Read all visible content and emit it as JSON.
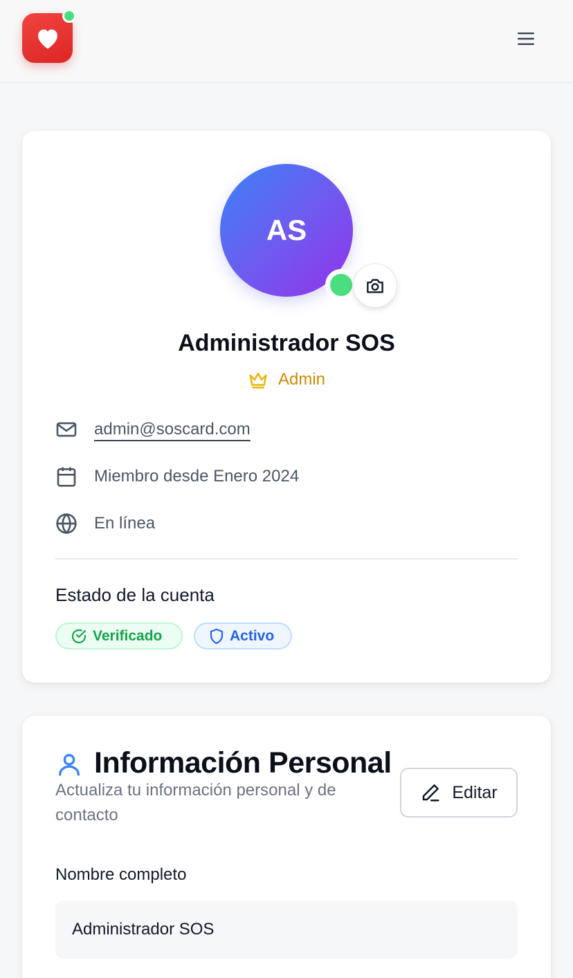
{
  "header": {
    "logo_icon": "heart-icon",
    "menu_icon": "hamburger-menu-icon"
  },
  "profile": {
    "initials": "AS",
    "name": "Administrador SOS",
    "role": "Admin",
    "email": "admin@soscard.com",
    "member_since": "Miembro desde Enero 2024",
    "presence": "En línea",
    "status_title": "Estado de la cuenta",
    "badges": {
      "verified": "Verificado",
      "active": "Activo"
    }
  },
  "personal_info": {
    "title": "Información Personal",
    "subtitle": "Actualiza tu información personal y de contacto",
    "edit_label": "Editar",
    "full_name_label": "Nombre completo",
    "full_name_value": "Administrador SOS"
  },
  "colors": {
    "brand_red": "#dc2626",
    "online_green": "#4ade80",
    "admin_gold": "#ca8a04",
    "verified_green": "#16a34a",
    "active_blue": "#2563eb"
  }
}
